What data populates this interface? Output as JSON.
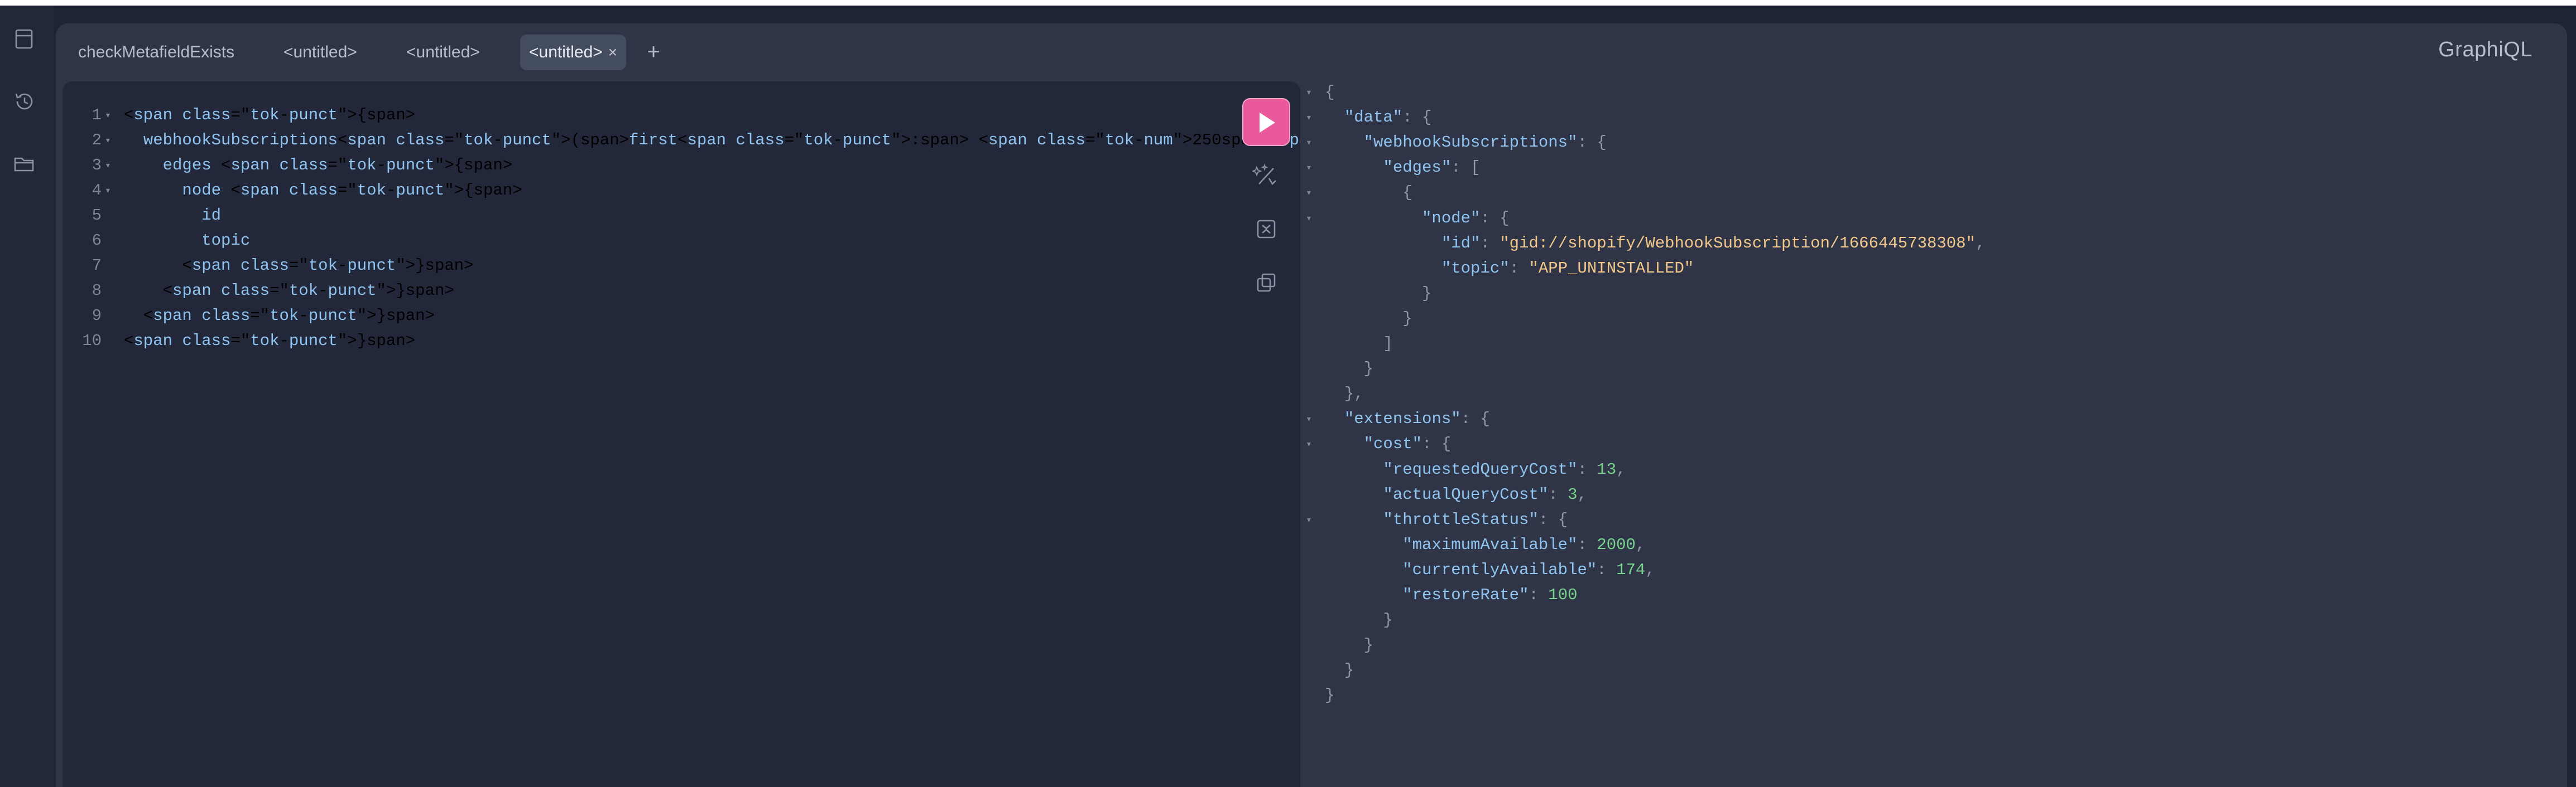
{
  "app": {
    "logo": "GraphiQL"
  },
  "sidebar": {
    "icons": [
      "docs-icon",
      "history-icon",
      "folder-icon"
    ]
  },
  "tabs": [
    {
      "label": "checkMetafieldExists",
      "active": false
    },
    {
      "label": "<untitled>",
      "active": false
    },
    {
      "label": "<untitled>",
      "active": false
    },
    {
      "label": "<untitled>",
      "active": true,
      "close": "×"
    }
  ],
  "add_tab": "+",
  "editor": {
    "lines": [
      {
        "num": "1",
        "text": "{"
      },
      {
        "num": "2",
        "text": "  webhookSubscriptions(first: 250) {"
      },
      {
        "num": "3",
        "text": "    edges {"
      },
      {
        "num": "4",
        "text": "      node {"
      },
      {
        "num": "5",
        "text": "        id"
      },
      {
        "num": "6",
        "text": "        topic"
      },
      {
        "num": "7",
        "text": "      }"
      },
      {
        "num": "8",
        "text": "    }"
      },
      {
        "num": "9",
        "text": "  }"
      },
      {
        "num": "10",
        "text": "}"
      }
    ]
  },
  "toolbar": [
    "run-button",
    "prettify-icon",
    "merge-fragments-icon",
    "copy-icon"
  ],
  "results": {
    "lines": [
      "{",
      "  \"data\": {",
      "    \"webhookSubscriptions\": {",
      "      \"edges\": [",
      "        {",
      "          \"node\": {",
      "            \"id\": \"gid://shopify/WebhookSubscription/1666445738308\",",
      "            \"topic\": \"APP_UNINSTALLED\"",
      "          }",
      "        }",
      "      ]",
      "    }",
      "  },",
      "  \"extensions\": {",
      "    \"cost\": {",
      "      \"requestedQueryCost\": 13,",
      "      \"actualQueryCost\": 3,",
      "      \"throttleStatus\": {",
      "        \"maximumAvailable\": 2000,",
      "        \"currentlyAvailable\": 174,",
      "        \"restoreRate\": 100",
      "      }",
      "    }",
      "  }",
      "}"
    ]
  },
  "colors": {
    "run_button": "#e8589a",
    "background": "#2f3546",
    "editor_bg": "#22283a",
    "string": "#f2c78a",
    "number": "#76d48c",
    "field": "#8fc4f0"
  }
}
